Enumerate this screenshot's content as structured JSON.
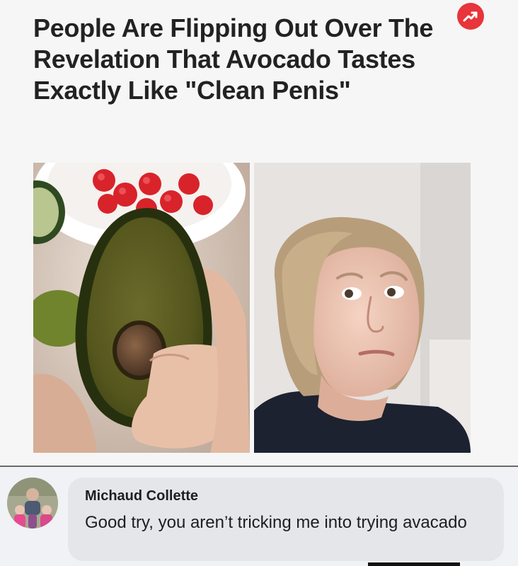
{
  "article": {
    "headline": "People Are Flipping Out Over The Revelation That Avocado Tastes Exactly Like \"Clean Penis\"",
    "badge_icon": "trending-arrow-icon",
    "badge_color": "#e8343b",
    "images": [
      {
        "name": "avocado-photo",
        "description_icon": "avocado-half-with-pit"
      },
      {
        "name": "reaction-photo",
        "description_icon": "woman-side-eye"
      }
    ]
  },
  "comment": {
    "author": "Michaud Collette",
    "text": "Good try, you aren’t tricking me into trying avacado",
    "avatar_icon": "profile-avatar"
  }
}
